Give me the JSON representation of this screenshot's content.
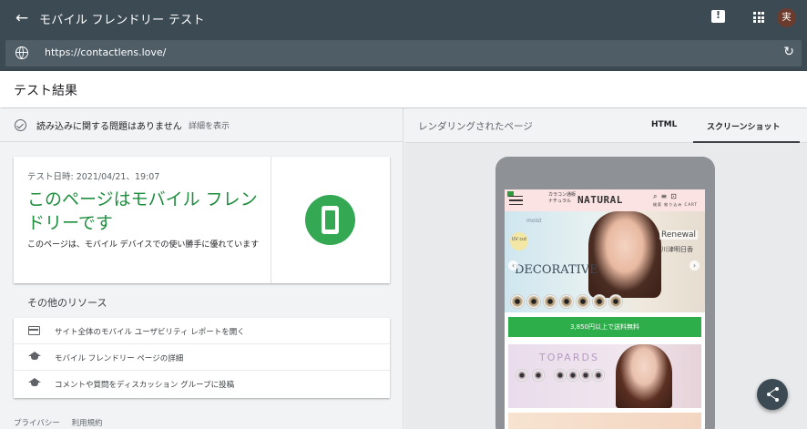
{
  "topbar": {
    "back_icon": "arrow-back-icon",
    "title": "モバイル フレンドリー テスト",
    "feedback_icon": "feedback-icon",
    "apps_icon": "apps-grid-icon",
    "avatar_text": "実"
  },
  "urlbar": {
    "url": "https://contactlens.love/",
    "refresh_icon": "↻"
  },
  "results": {
    "heading": "テスト結果"
  },
  "left": {
    "issue_message": "読み込みに関する問題はありません",
    "issue_detail_link": "詳細を表示",
    "card": {
      "date": "テスト日時: 2021/04/21、19:07",
      "verdict": "このページはモバイル フレンドリーです",
      "description": "このページは、モバイル デバイスでの使い勝手に優れています"
    },
    "other_resources_heading": "その他のリソース",
    "resources": [
      {
        "label": "サイト全体のモバイル ユーザビリティ レポートを開く",
        "icon": "report-icon"
      },
      {
        "label": "モバイル フレンドリー ページの詳細",
        "icon": "school-icon"
      },
      {
        "label": "コメントや質問をディスカッション グループに投稿",
        "icon": "school-icon"
      }
    ],
    "footer": {
      "privacy": "プライバシー",
      "terms": "利用規約"
    }
  },
  "right": {
    "heading": "レンダリングされたページ",
    "tabs": [
      {
        "label": "HTML",
        "active": false
      },
      {
        "label": "スクリーンショット",
        "active": true
      }
    ],
    "screenshot": {
      "header_sub": "カラコン通販 ナチュラル",
      "brand": "NATURAL",
      "header_labels": "検索 絞り込み CART",
      "hero_moist": "moist",
      "hero_uv": "UV cut",
      "hero_logo": "DECORATIVE",
      "hero_renewal": "Renewal",
      "hero_name": "川津明日香",
      "promo": "3,850円以上で送料無料",
      "banner2_title": "TOPARDS"
    },
    "share_icon": "share-icon"
  },
  "colors": {
    "topbar_bg": "#3c4a54",
    "success_green": "#1e8e3e",
    "badge_green": "#34a853",
    "promo_green": "#2eae4a"
  }
}
